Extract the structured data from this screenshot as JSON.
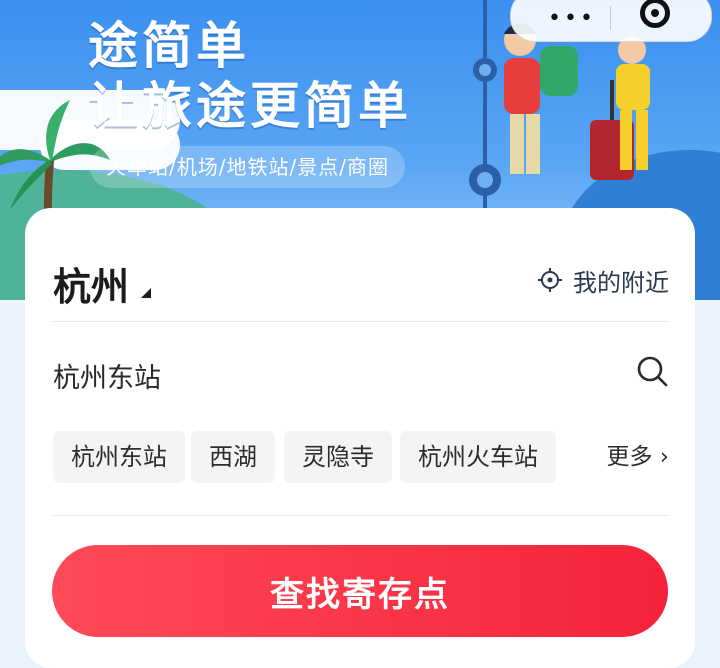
{
  "banner": {
    "headline_line1": "途简单",
    "headline_line2": "让旅途更简单",
    "categories": "火车站/机场/地铁站/景点/商圈"
  },
  "wechat_capsule": {
    "menu_icon": "more-dots-icon",
    "close_icon": "close-target-icon",
    "dots_glyph": "•••"
  },
  "location": {
    "city": "杭州",
    "nearby_label": "我的附近",
    "nearby_icon": "locate-crosshair-icon"
  },
  "search": {
    "current_value": "杭州东站",
    "icon": "search-icon"
  },
  "quick_tags": [
    {
      "label": "杭州东站"
    },
    {
      "label": "西湖"
    },
    {
      "label": "灵隐寺"
    },
    {
      "label": "杭州火车站"
    }
  ],
  "more_label": "更多",
  "cta_label": "查找寄存点",
  "colors": {
    "brand_red": "#f5233a",
    "banner_blue": "#3b8ff0",
    "text_dark": "#1c1c1c"
  }
}
